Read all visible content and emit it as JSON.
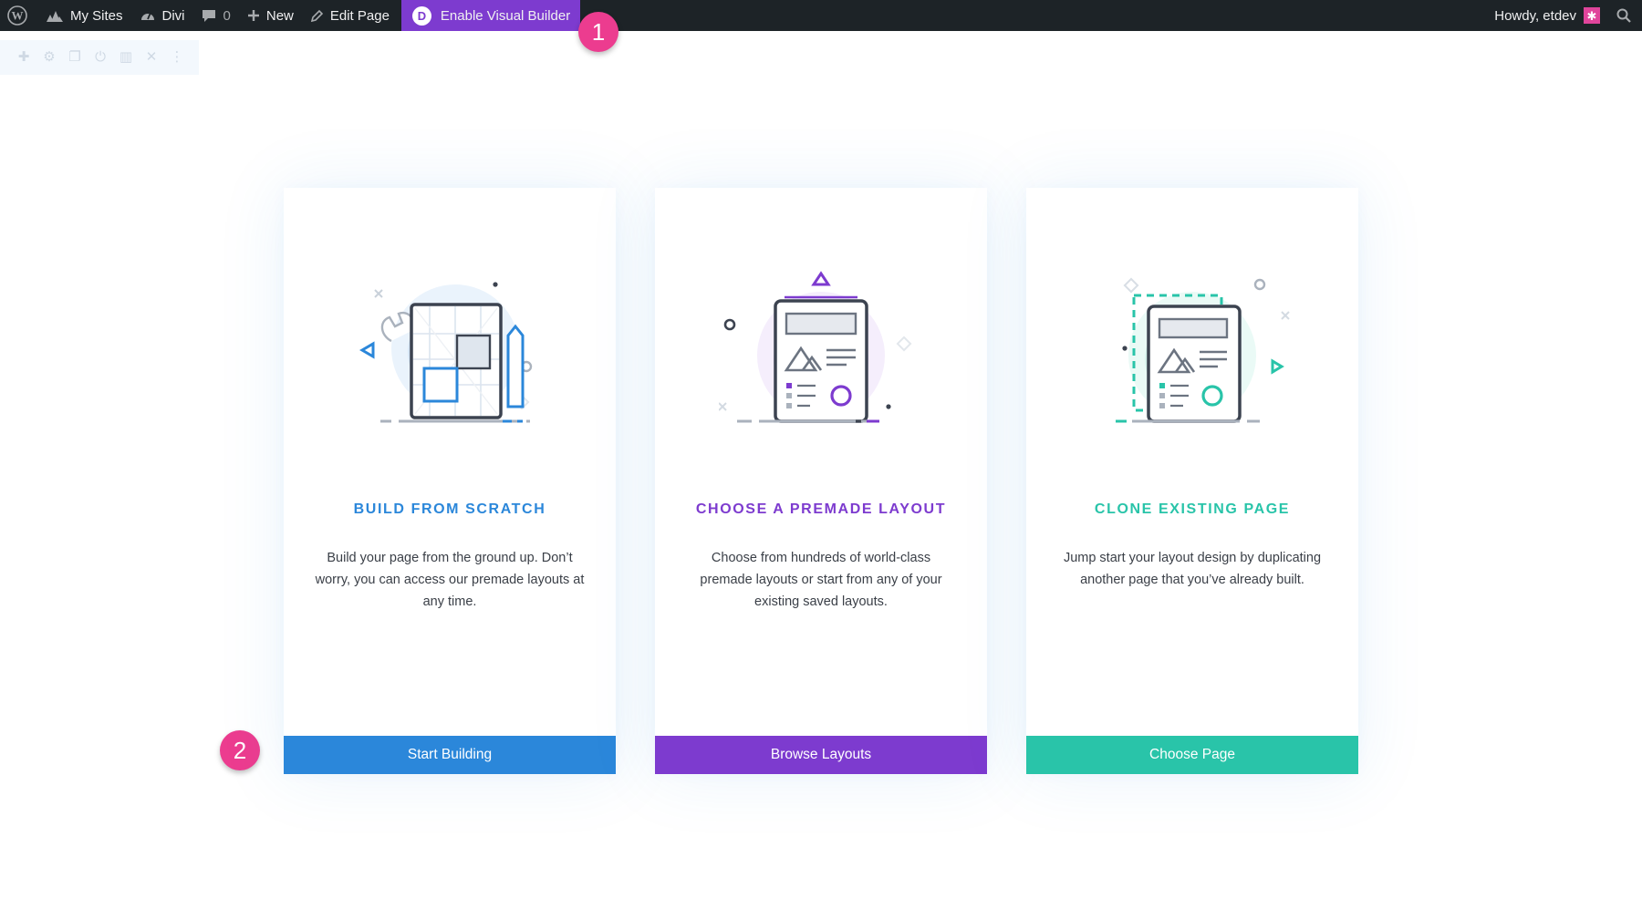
{
  "adminbar": {
    "my_sites": "My Sites",
    "site_name": "Divi",
    "comments_count": "0",
    "new_label": "New",
    "edit_page": "Edit Page",
    "builder_badge": "D",
    "enable_builder": "Enable Visual Builder",
    "howdy": "Howdy, etdev"
  },
  "steps": [
    "1",
    "2"
  ],
  "cards": [
    {
      "title": "BUILD FROM SCRATCH",
      "description": "Build your page from the ground up. Don’t worry, you can access our premade layouts at any time.",
      "button": "Start Building",
      "accent": "#2b87da"
    },
    {
      "title": "CHOOSE A PREMADE LAYOUT",
      "description": "Choose from hundreds of world-class premade layouts or start from any of your existing saved layouts.",
      "button": "Browse Layouts",
      "accent": "#7d3bcf"
    },
    {
      "title": "CLONE EXISTING PAGE",
      "description": "Jump start your layout design by duplicating another page that you’ve already built.",
      "button": "Choose Page",
      "accent": "#29c4a9"
    }
  ],
  "colors": {
    "adminbar_bg": "#1d2327",
    "builder_purple": "#7d3bcf",
    "step_pink": "#ec3c8f",
    "blue": "#2b87da",
    "purple": "#7d3bcf",
    "teal": "#29c4a9"
  }
}
